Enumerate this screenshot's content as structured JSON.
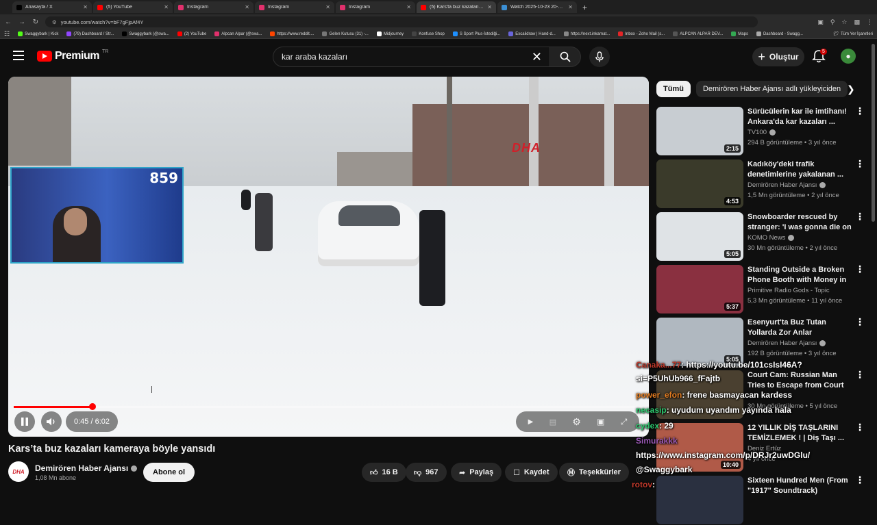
{
  "browser": {
    "tabs": [
      {
        "label": "Anasayfa / X",
        "color": "#000000"
      },
      {
        "label": "(5) YouTube",
        "color": "#ff0000"
      },
      {
        "label": "Instagram",
        "color": "#e1306c"
      },
      {
        "label": "Instagram",
        "color": "#e1306c"
      },
      {
        "label": "Instagram",
        "color": "#e1306c"
      },
      {
        "label": "(5) Kars'ta buz kazaları kam",
        "color": "#ff0000"
      },
      {
        "label": "Watch 2025-10-23 20-01-57 | S",
        "color": "#3b8fd4"
      }
    ],
    "url": "youtube.com/watch?v=bF7gFjpAf4Y",
    "bookmarks": [
      "Swaggybark | Kick",
      "(79) Dashboard / Str...",
      "Swaggybark (@swa...",
      "(2) YouTube",
      "Alpcan Alpar (@swa...",
      "https://www.reddit....",
      "Gelen Kutusu (31) -...",
      "Midjourney",
      "Konfuse Shop",
      "S Sport Plus-İstediği...",
      "Excalidraw | Hand-d...",
      "https://next.inkarnat...",
      "Inbox - Zoho Mail (s...",
      "ALPCAN ALPAR DEV...",
      "Maps",
      "Dashboard - Swagg..."
    ],
    "bookmarks_all": "Tüm Yer İşaretleri"
  },
  "header": {
    "logo_text": "Premium",
    "logo_country": "TR",
    "search_value": "kar araba kazaları",
    "create_label": "Oluştur",
    "notification_count": "5"
  },
  "player": {
    "watermark": "DHA",
    "facecam_count": "859",
    "time": "0:45 / 6:02",
    "progress_fraction": 0.125
  },
  "video": {
    "title": "Kars’ta buz kazaları kameraya böyle yansıdı",
    "channel": "Demirören Haber Ajansı",
    "channel_logo": "DHA",
    "subscribers": "1,08 Mn abone",
    "subscribe_label": "Abone ol",
    "likes": "16 B",
    "dislikes": "967",
    "share_label": "Paylaş",
    "save_label": "Kaydet",
    "thanks_label": "Teşekkürler"
  },
  "sidebar": {
    "chips": [
      "Tümü",
      "Demirören Haber Ajansı adlı yükleyiciden"
    ],
    "items": [
      {
        "title": "Sürücülerin kar ile imtihanı! Ankara'da kar kazaları ...",
        "channel": "TV100",
        "verified": true,
        "meta": "294 B görüntüleme • 3 yıl önce",
        "duration": "2:15",
        "thumb": "#c8cdd2"
      },
      {
        "title": "Kadıköy'deki trafik denetimlerine yakalanan ...",
        "channel": "Demirören Haber Ajansı",
        "verified": true,
        "meta": "1,5 Mn görüntüleme • 2 yıl önce",
        "duration": "4:53",
        "thumb": "#3a3a2a"
      },
      {
        "title": "Snowboarder rescued by stranger: 'I was gonna die on ...",
        "channel": "KOMO News",
        "verified": true,
        "meta": "30 Mn görüntüleme • 2 yıl önce",
        "duration": "5:05",
        "thumb": "#dfe3e6"
      },
      {
        "title": "Standing Outside a Broken Phone Booth with Money in M...",
        "channel": "Primitive Radio Gods - Topic",
        "verified": false,
        "meta": "5,3 Mn görüntüleme • 11 yıl önce",
        "duration": "5:37",
        "thumb": "#8a3040"
      },
      {
        "title": "Esenyurt'ta Buz Tutan Yollarda Zor Anlar",
        "channel": "Demirören Haber Ajansı",
        "verified": true,
        "meta": "192 B görüntüleme • 3 yıl önce",
        "duration": "5:05",
        "thumb": "#b0b8c0"
      },
      {
        "title": "Court Cam: Russian Man Tries to Escape from Court (Season ...",
        "channel": "",
        "verified": false,
        "meta": "30 Mn görüntüleme • 5 yıl önce",
        "duration": "",
        "thumb": "#4a4030"
      },
      {
        "title": "12 YILLIK DİŞ TAŞLARINI TEMİZLEMEK ! | Diş Taşı ...",
        "channel": "Deniz Ertüz",
        "verified": false,
        "meta": "4 yıl önce",
        "duration": "10:40",
        "thumb": "#b05a48"
      },
      {
        "title": "Sixteen Hundred Men (From \"1917\" Soundtrack)",
        "channel": "",
        "verified": false,
        "meta": "",
        "duration": "",
        "thumb": "#2a3040"
      }
    ]
  },
  "chat": [
    {
      "user": "Canaka...77",
      "text": ": https://youtu.be/101csIsI46A?"
    },
    {
      "user": "",
      "text": "si=P5UhUb966_fFajtb"
    },
    {
      "user": "power_efon",
      "text": ": frene basmayacan kardess"
    },
    {
      "user": "necasip",
      "text": ": uyudum uyandım yayında hala"
    },
    {
      "user": "cydex",
      "text": ": 29"
    },
    {
      "user": "Simurakkk",
      "text": ""
    },
    {
      "user": "",
      "text": "https://www.instagram.com/p/DRJr2uwDGlu/"
    },
    {
      "user": "",
      "text": "@Swaggybark"
    },
    {
      "user": "rotov",
      "text": ":"
    }
  ]
}
